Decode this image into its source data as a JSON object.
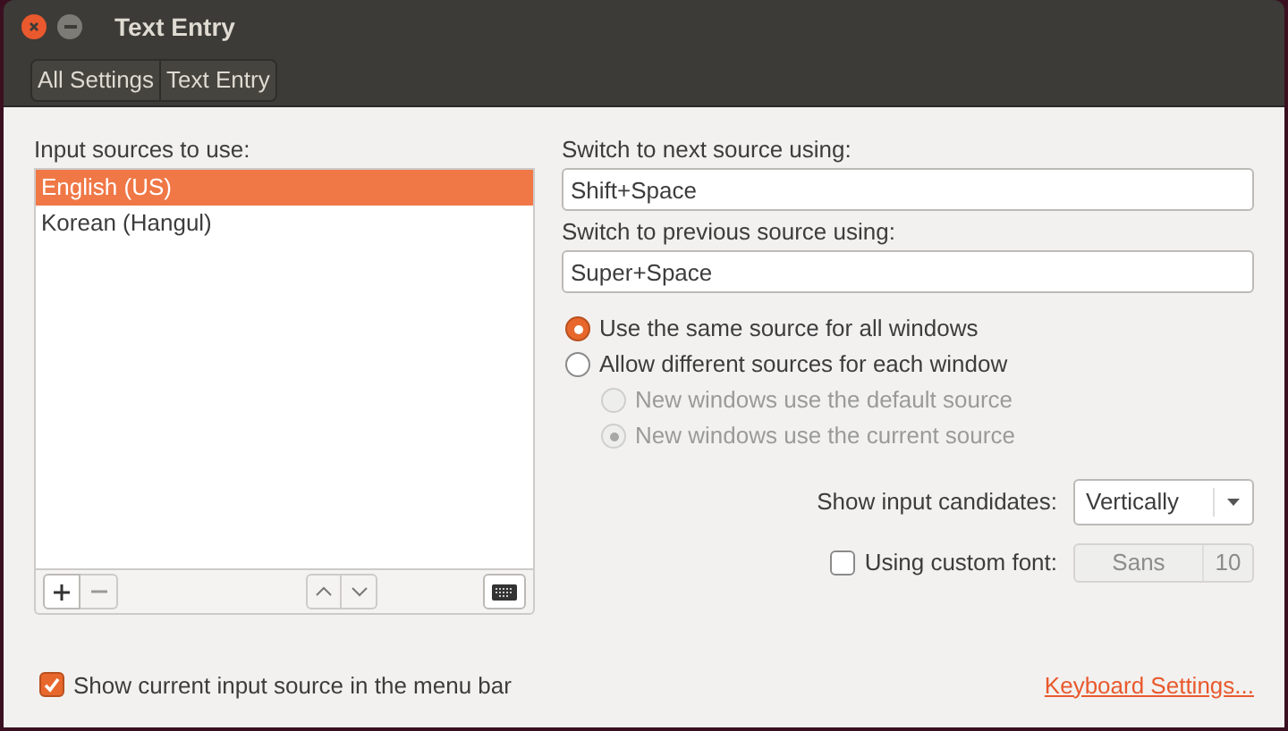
{
  "window": {
    "title": "Text Entry"
  },
  "breadcrumbs": [
    "All Settings",
    "Text Entry"
  ],
  "sources": {
    "label": "Input sources to use:",
    "items": [
      {
        "label": "English (US)",
        "selected": true
      },
      {
        "label": "Korean (Hangul)",
        "selected": false
      }
    ]
  },
  "show_in_menu_bar": {
    "label": "Show current input source in the menu bar",
    "checked": true
  },
  "next_source": {
    "label": "Switch to next source using:",
    "value": "Shift+Space"
  },
  "previous_source": {
    "label": "Switch to previous source using:",
    "value": "Super+Space"
  },
  "source_mode": [
    {
      "label": "Use the same source for all windows",
      "selected": true,
      "disabled": false
    },
    {
      "label": "Allow different sources for each window",
      "selected": false,
      "disabled": false,
      "children": [
        {
          "label": "New windows use the default source",
          "selected": false,
          "disabled": true
        },
        {
          "label": "New windows use the current source",
          "selected": true,
          "disabled": true
        }
      ]
    }
  ],
  "candidates": {
    "label": "Show input candidates:",
    "value": "Vertically"
  },
  "custom_font": {
    "label": "Using custom font:",
    "checked": false,
    "font": "Sans",
    "size": "10"
  },
  "keyboard_settings_link": "Keyboard Settings..."
}
